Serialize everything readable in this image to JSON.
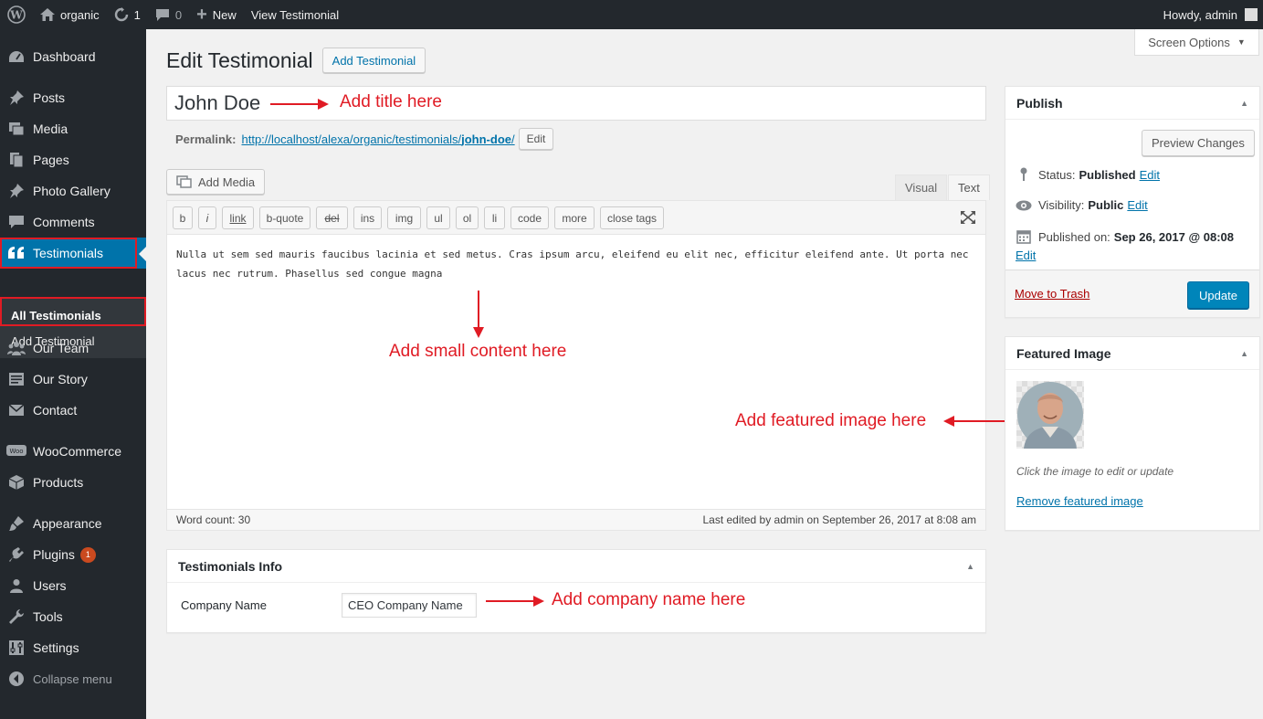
{
  "adminbar": {
    "site_name": "organic",
    "updates_count": "1",
    "comments_count": "0",
    "new_label": "New",
    "view_label": "View Testimonial",
    "howdy": "Howdy, admin"
  },
  "sidebar": {
    "items": [
      {
        "label": "Dashboard",
        "icon": "dashboard-icon"
      },
      {
        "label": "Posts",
        "icon": "pin-icon"
      },
      {
        "label": "Media",
        "icon": "media-icon"
      },
      {
        "label": "Pages",
        "icon": "pages-icon"
      },
      {
        "label": "Photo Gallery",
        "icon": "pin-icon"
      },
      {
        "label": "Comments",
        "icon": "comment-icon"
      },
      {
        "label": "Testimonials",
        "icon": "quote-icon"
      },
      {
        "label": "Our Team",
        "icon": "team-icon"
      },
      {
        "label": "Our Story",
        "icon": "story-icon"
      },
      {
        "label": "Contact",
        "icon": "mail-icon"
      },
      {
        "label": "WooCommerce",
        "icon": "woo-icon"
      },
      {
        "label": "Products",
        "icon": "products-icon"
      },
      {
        "label": "Appearance",
        "icon": "brush-icon"
      },
      {
        "label": "Plugins",
        "icon": "plugin-icon",
        "badge": "1"
      },
      {
        "label": "Users",
        "icon": "user-icon"
      },
      {
        "label": "Tools",
        "icon": "wrench-icon"
      },
      {
        "label": "Settings",
        "icon": "settings-icon"
      },
      {
        "label": "Collapse menu",
        "icon": "collapse-icon"
      }
    ],
    "submenu": {
      "all": "All Testimonials",
      "add": "Add Testimonial"
    }
  },
  "main": {
    "screen_options": "Screen Options",
    "page_title": "Edit Testimonial",
    "add_new": "Add Testimonial",
    "post_title": "John Doe",
    "permalink_label": "Permalink:",
    "permalink_base": "http://localhost/alexa/organic/testimonials/",
    "permalink_slug": "john-doe",
    "permalink_end": "/",
    "permalink_edit": "Edit",
    "add_media": "Add Media",
    "tab_visual": "Visual",
    "tab_text": "Text",
    "quicktags": [
      "b",
      "i",
      "link",
      "b-quote",
      "del",
      "ins",
      "img",
      "ul",
      "ol",
      "li",
      "code",
      "more",
      "close tags"
    ],
    "content": "Nulla ut sem sed mauris faucibus lacinia et sed metus. Cras ipsum arcu, eleifend eu elit nec, efficitur eleifend ante. Ut porta nec lacus nec rutrum. Phasellus sed congue magna",
    "word_count": "Word count: 30",
    "last_edited": "Last edited by admin on September 26, 2017 at 8:08 am"
  },
  "testimonials_info": {
    "title": "Testimonials Info",
    "company_label": "Company Name",
    "company_value": "CEO Company Name"
  },
  "publish": {
    "title": "Publish",
    "preview": "Preview Changes",
    "status_label": "Status:",
    "status_value": "Published",
    "visibility_label": "Visibility:",
    "visibility_value": "Public",
    "published_label": "Published on:",
    "published_value": "Sep 26, 2017 @ 08:08",
    "edit": "Edit",
    "trash": "Move to Trash",
    "update": "Update"
  },
  "featured": {
    "title": "Featured Image",
    "hint": "Click the image to edit or update",
    "remove": "Remove featured image"
  },
  "annotations": {
    "title": "Add title here",
    "content": "Add small content here",
    "featured": "Add featured image here",
    "company": "Add company name here"
  },
  "colors": {
    "accent": "#0073aa",
    "annotation": "#e01b24",
    "adminbar": "#23282d"
  }
}
